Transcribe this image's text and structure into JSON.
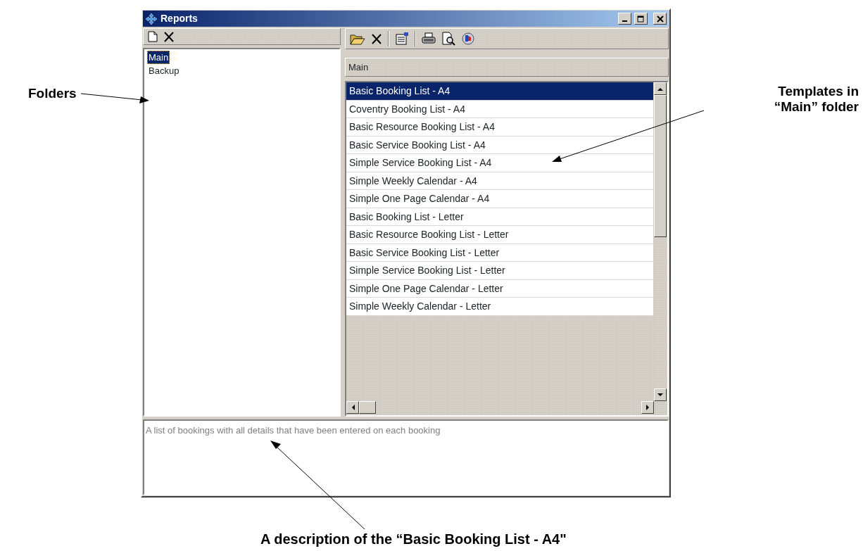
{
  "window": {
    "title": "Reports"
  },
  "folders": [
    {
      "label": "Main",
      "selected": true
    },
    {
      "label": "Backup",
      "selected": false
    }
  ],
  "templates": {
    "header": "Main",
    "items": [
      {
        "label": "Basic Booking List - A4",
        "selected": true
      },
      {
        "label": "Coventry Booking List - A4",
        "selected": false
      },
      {
        "label": "Basic Resource Booking List - A4",
        "selected": false
      },
      {
        "label": "Basic Service Booking List - A4",
        "selected": false
      },
      {
        "label": "Simple Service Booking List - A4",
        "selected": false
      },
      {
        "label": "Simple Weekly Calendar - A4",
        "selected": false
      },
      {
        "label": "Simple One Page Calendar - A4",
        "selected": false
      },
      {
        "label": "Basic Booking List - Letter",
        "selected": false
      },
      {
        "label": "Basic Resource Booking List - Letter",
        "selected": false
      },
      {
        "label": "Basic Service Booking List - Letter",
        "selected": false
      },
      {
        "label": "Simple Service Booking List - Letter",
        "selected": false
      },
      {
        "label": "Simple One Page Calendar - Letter",
        "selected": false
      },
      {
        "label": "Simple Weekly Calendar - Letter",
        "selected": false
      }
    ]
  },
  "description": "A list of bookings with all details that have been entered on each booking",
  "annotations": {
    "folders": "Folders",
    "templates": "Templates in “Main” folder",
    "description": "A description of the “Basic Booking List - A4\""
  }
}
